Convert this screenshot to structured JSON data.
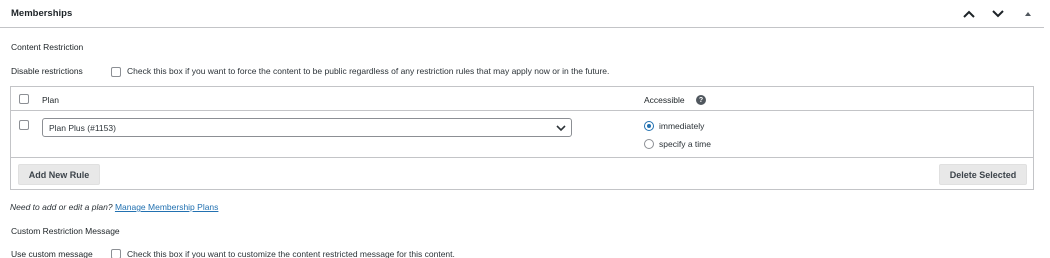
{
  "metabox": {
    "title": "Memberships",
    "move_up_icon": "chevron-up-icon",
    "move_down_icon": "chevron-down-icon",
    "toggle_icon": "triangle-up-icon"
  },
  "content_restriction": {
    "heading": "Content Restriction",
    "disable_label": "Disable restrictions",
    "disable_checked": false,
    "disable_description": "Check this box if you want to force the content to be public regardless of any restriction rules that may apply now or in the future."
  },
  "rules_table": {
    "columns": {
      "plan": "Plan",
      "accessible": "Accessible"
    },
    "help_icon": "question-circle-icon",
    "rows": [
      {
        "checked": false,
        "plan": "Plan Plus (#1153)",
        "access_options": [
          {
            "label": "immediately",
            "selected": true
          },
          {
            "label": "specify a time",
            "selected": false
          }
        ]
      }
    ],
    "add_button": "Add New Rule",
    "delete_button": "Delete Selected"
  },
  "help": {
    "prefix": "Need to add or edit a plan?",
    "link": "Manage Membership Plans"
  },
  "custom_message": {
    "heading": "Custom Restriction Message",
    "label": "Use custom message",
    "checked": false,
    "description": "Check this box if you want to customize the content restricted message for this content."
  },
  "colors": {
    "accent": "#2271b1",
    "border": "#c3c4c7",
    "button_bg": "#e8e8e8"
  }
}
